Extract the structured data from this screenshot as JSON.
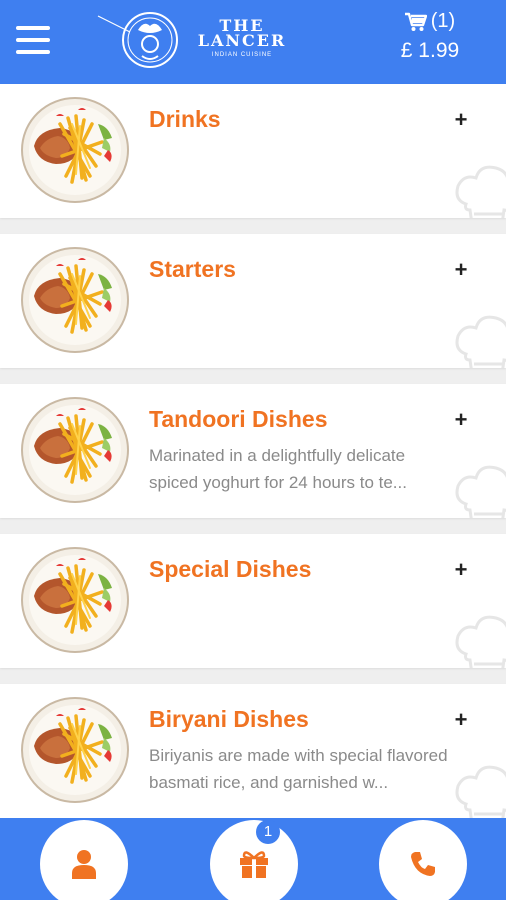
{
  "header": {
    "logo_title_line1": "THE",
    "logo_title_line2": "LANCER",
    "logo_subtitle": "INDIAN CUISINE",
    "cart_count": "(1)",
    "cart_total": "£ 1.99",
    "cart_icon": "cart-icon",
    "menu_icon": "hamburger-icon"
  },
  "categories": [
    {
      "title": "Drinks",
      "desc_line1": "",
      "desc_line2": ""
    },
    {
      "title": "Starters",
      "desc_line1": "",
      "desc_line2": ""
    },
    {
      "title": "Tandoori Dishes",
      "desc_line1": "Marinated in a delightfully delicate",
      "desc_line2": "spiced yoghurt for 24 hours to te..."
    },
    {
      "title": "Special Dishes",
      "desc_line1": "",
      "desc_line2": ""
    },
    {
      "title": "Biryani Dishes",
      "desc_line1": "Biriyanis are made with special flavored",
      "desc_line2": "basmati rice, and garnished w..."
    }
  ],
  "expand_symbol": "+",
  "bottom_bar": {
    "profile_icon": "person-icon",
    "offers_icon": "gift-icon",
    "offers_badge": "1",
    "call_icon": "phone-icon"
  },
  "colors": {
    "primary": "#3f7ff0",
    "accent": "#f07322",
    "text_muted": "#8a8a8a"
  }
}
